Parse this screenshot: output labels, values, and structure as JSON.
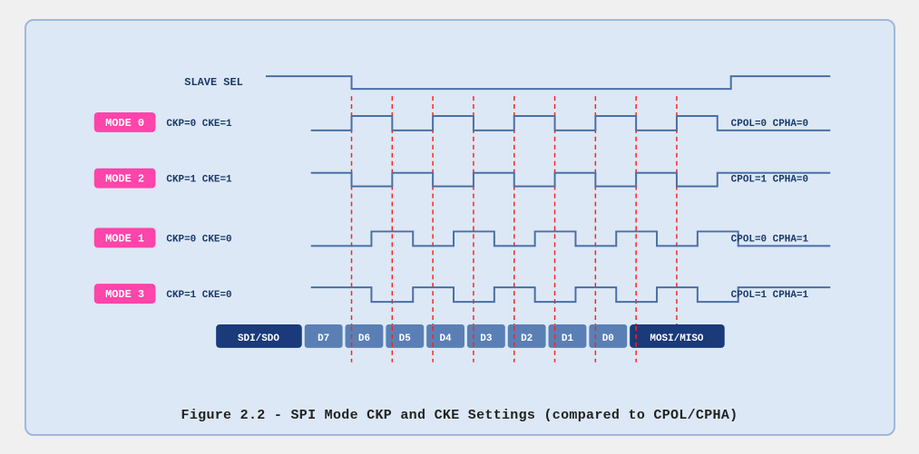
{
  "caption": "Figure 2.2 - SPI Mode CKP and CKE Settings (compared to CPOL/CPHA)",
  "diagram": {
    "slave_sel_label": "SLAVE SEL",
    "modes": [
      {
        "label": "MODE 0",
        "params": "CKP=0  CKE=1",
        "right": "CPOL=0  CPHA=0"
      },
      {
        "label": "MODE 2",
        "params": "CKP=1  CKE=1",
        "right": "CPOL=1  CPHA=0"
      },
      {
        "label": "MODE 1",
        "params": "CKP=0  CKE=0",
        "right": "CPOL=0  CPHA=1"
      },
      {
        "label": "MODE 3",
        "params": "CKP=1  CKE=0",
        "right": "CPOL=1  CPHA=1"
      }
    ],
    "data_bits": [
      "SDI/SDO",
      "D7",
      "D6",
      "D5",
      "D4",
      "D3",
      "D2",
      "D1",
      "D0",
      "MOSI/MISO"
    ]
  }
}
